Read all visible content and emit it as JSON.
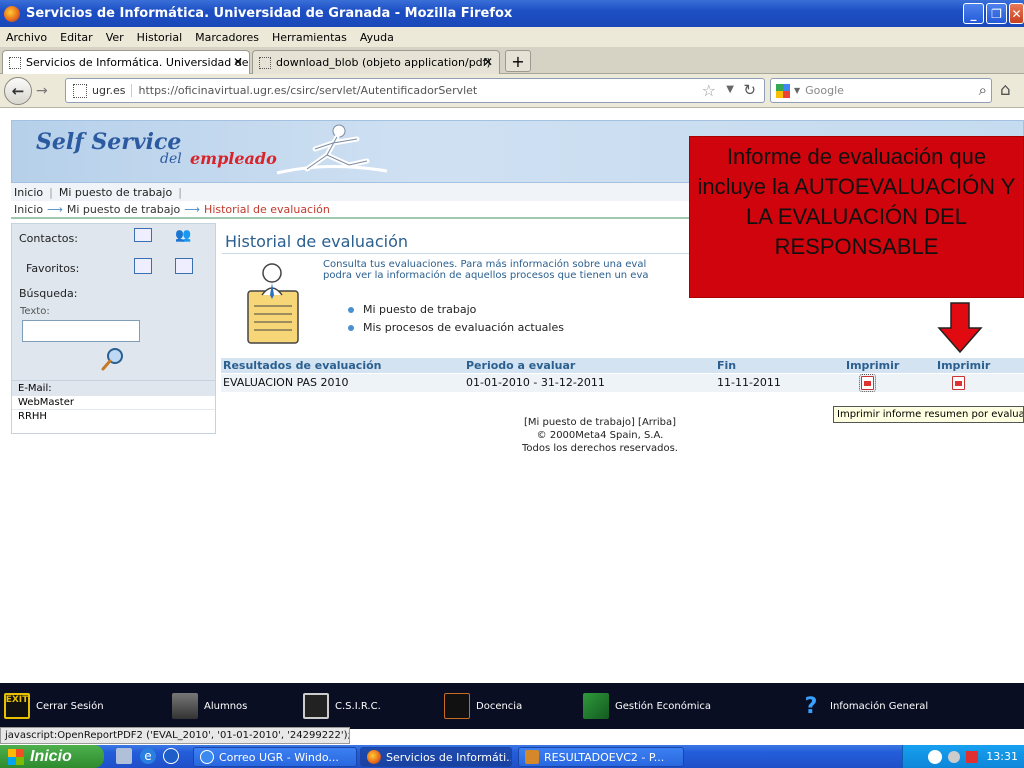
{
  "window": {
    "title": "Servicios de Informática. Universidad de Granada - Mozilla Firefox"
  },
  "menu": [
    "Archivo",
    "Editar",
    "Ver",
    "Historial",
    "Marcadores",
    "Herramientas",
    "Ayuda"
  ],
  "tabs": [
    {
      "label": "Servicios de Informática. Universidad de ...",
      "active": true
    },
    {
      "label": "download_blob (objeto application/pdf)",
      "active": false
    }
  ],
  "nav": {
    "domain": "ugr.es",
    "url": "https://oficinavirtual.ugr.es/csirc/servlet/AutentificadorServlet",
    "search_placeholder": "Google"
  },
  "brand": {
    "line1": "Self Service",
    "line2": "del",
    "line3": "empleado"
  },
  "topnav": [
    "Inicio",
    "Mi puesto de trabajo"
  ],
  "breadcrumb": [
    "Inicio",
    "Mi puesto de trabajo",
    "Historial de evaluación"
  ],
  "sidebar": {
    "contactos": "Contactos:",
    "favoritos": "Favoritos:",
    "busqueda": "Búsqueda:",
    "texto": "Texto:",
    "email": "E-Mail:",
    "links": [
      "WebMaster",
      "RRHH"
    ]
  },
  "main": {
    "title": "Historial de evaluación",
    "desc_line1": "Consulta tus evaluaciones. Para más información sobre una eval",
    "desc_line2": "podra ver la información de aquellos procesos que tienen un eva",
    "bullets": [
      "Mi puesto de trabajo",
      "Mis procesos de evaluación actuales"
    ]
  },
  "table": {
    "headers": [
      "Resultados de evaluación",
      "Periodo a evaluar",
      "Fin",
      "Imprimir",
      "Imprimir"
    ],
    "rows": [
      {
        "resultado": "EVALUACION PAS 2010",
        "periodo": "01-01-2010 - 31-12-2011",
        "fin": "11-11-2011"
      }
    ]
  },
  "tooltip": "Imprimir informe resumen por evaluado",
  "footer": {
    "links": "[Mi puesto de trabajo] [Arriba]",
    "copyright": "© 2000Meta4 Spain, S.A.",
    "rights": "Todos los derechos reservados."
  },
  "callout": "Informe de evaluación que incluye la AUTOEVALUACIÓN Y LA EVALUACIÓN DEL RESPONSABLE",
  "appbar": [
    "Cerrar Sesión",
    "Alumnos",
    "C.S.I.R.C.",
    "Docencia",
    "Gestión Económica",
    "Infomación General"
  ],
  "appbar_exit": "EXIT",
  "status": "javascript:OpenReportPDF2 ('EVAL_2010', '01-01-2010', '24299222');",
  "taskbar": {
    "start": "Inicio",
    "tasks": [
      "Correo UGR - Windo...",
      "Servicios de Informáti...",
      "RESULTADOEVC2 - P..."
    ],
    "clock": "13:31"
  },
  "colors": {
    "callout": "#d0040c",
    "title_blue": "#2a5f8f",
    "breadcrumb_current": "#c0392b"
  }
}
